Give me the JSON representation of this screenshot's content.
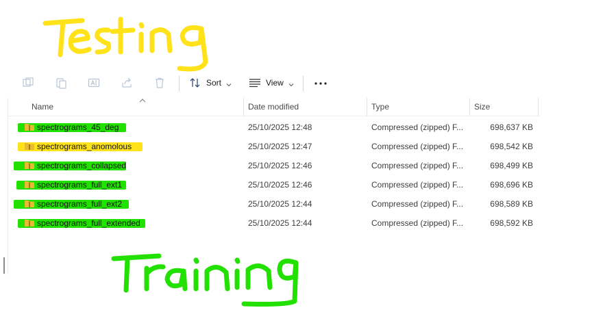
{
  "annotations": {
    "top_label": "Testing",
    "bottom_label": "Training",
    "top_color": "#ffe21a",
    "bottom_color": "#22e000"
  },
  "toolbar": {
    "icons": [
      "new-item-icon",
      "copy-icon",
      "rename-icon",
      "share-icon",
      "delete-icon"
    ],
    "sort_label": "Sort",
    "view_label": "View",
    "more_label": "..."
  },
  "columns": {
    "name": "Name",
    "date": "Date modified",
    "type": "Type",
    "size": "Size"
  },
  "files": [
    {
      "name": "spectrograms_45_deg",
      "date": "25/10/2025 12:48",
      "type": "Compressed (zipped) F...",
      "size": "698,637 KB",
      "highlight": "green"
    },
    {
      "name": "spectrograms_anomolous",
      "date": "25/10/2025 12:47",
      "type": "Compressed (zipped) F...",
      "size": "698,542 KB",
      "highlight": "yellow"
    },
    {
      "name": "spectrograms_collapsed",
      "date": "25/10/2025 12:46",
      "type": "Compressed (zipped) F...",
      "size": "698,499 KB",
      "highlight": "green"
    },
    {
      "name": "spectrograms_full_ext1",
      "date": "25/10/2025 12:46",
      "type": "Compressed (zipped) F...",
      "size": "698,696 KB",
      "highlight": "green"
    },
    {
      "name": "spectrograms_full_ext2",
      "date": "25/10/2025 12:44",
      "type": "Compressed (zipped) F...",
      "size": "698,589 KB",
      "highlight": "green"
    },
    {
      "name": "spectrograms_full_extended",
      "date": "25/10/2025 12:44",
      "type": "Compressed (zipped) F...",
      "size": "698,592 KB",
      "highlight": "green"
    }
  ],
  "colors": {
    "highlight_green": "#22e000",
    "highlight_yellow": "#ffe21a",
    "zip_folder": "#e8b931"
  }
}
